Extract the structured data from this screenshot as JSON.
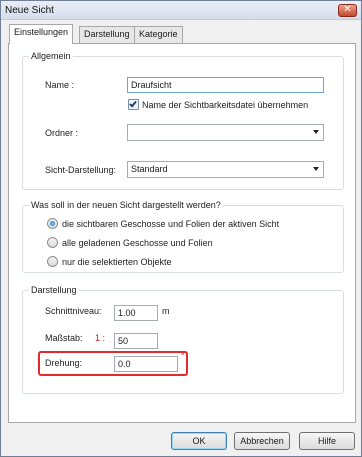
{
  "window": {
    "title": "Neue Sicht",
    "close_glyph": "✕"
  },
  "tabs": [
    {
      "label": "Einstellungen",
      "active": true
    },
    {
      "label": "Darstellung",
      "active": false
    },
    {
      "label": "Kategorie",
      "active": false
    }
  ],
  "allgemein": {
    "group_label": "Allgemein",
    "name_label": "Name :",
    "name_value": "Draufsicht",
    "checkbox_label": "Name der Sichtbarkeitsdatei übernehmen",
    "checkbox_checked": true,
    "ordner_label": "Ordner :",
    "ordner_value": "",
    "darstellung_label": "Sicht-Darstellung:",
    "darstellung_value": "Standard"
  },
  "anzeige": {
    "group_label": "Was soll in der neuen Sicht dargestellt werden?",
    "options": [
      {
        "label": "die sichtbaren Geschosse und Folien der aktiven Sicht",
        "checked": true
      },
      {
        "label": "alle geladenen Geschosse und Folien",
        "checked": false
      },
      {
        "label": "nur die selektierten Objekte",
        "checked": false
      }
    ]
  },
  "darstellung": {
    "group_label": "Darstellung",
    "schnitt_label": "Schnittniveau:",
    "schnitt_value": "1.00",
    "schnitt_unit": "m",
    "massstab_label": "Maßstab:",
    "massstab_prefix": "1 :",
    "massstab_value": "50",
    "drehung_label": "Drehung:",
    "drehung_value": "0.0",
    "drehung_unit": "°",
    "highlight_color": "#e32b2b"
  },
  "buttons": {
    "ok": "OK",
    "cancel": "Abbrechen",
    "help": "Hilfe"
  }
}
